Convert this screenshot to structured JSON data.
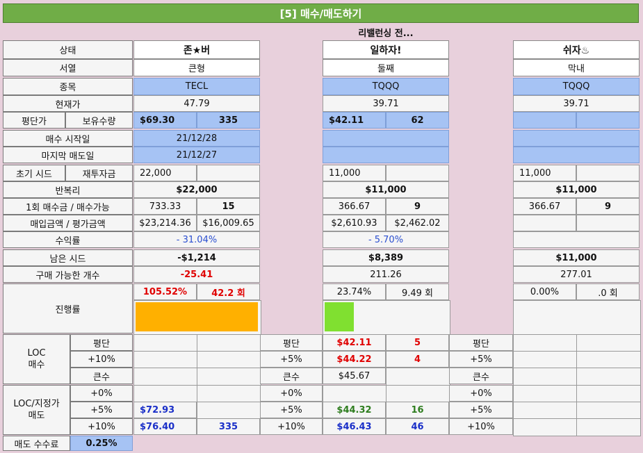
{
  "title": "[5] 매수/매도하기",
  "subtitle": "리밸런싱 전...",
  "labels": {
    "status": "상태",
    "order": "서열",
    "ticker": "종목",
    "price": "현재가",
    "avg": "평단가",
    "qty": "보유수량",
    "buy_start": "매수 시작일",
    "last_sell": "마지막 매도일",
    "seed": "초기 시드",
    "reinvest": "재투자금",
    "compound": "반복리",
    "per_buy": "1회 매수금 / 매수가능",
    "cost_eval": "매입금액 / 평가금액",
    "return": "수익률",
    "remain": "남은 시드",
    "buyable": "구매 가능한 개수",
    "progress": "진행률",
    "loc_buy": "LOC\n매수",
    "loc_sell": "LOC/지정가\n매도",
    "fee": "매도 수수료",
    "fee_value": "0.25%"
  },
  "players": [
    {
      "name": "존★버",
      "rank": "큰형",
      "ticker": "TECL",
      "price": "47.79",
      "avg": "$69.30",
      "qty": "335",
      "buy_start": "21/12/28",
      "last_sell": "21/12/27",
      "seed": "22,000",
      "reinvest": "",
      "compound": "$22,000",
      "per_buy": "733.33",
      "buyable_count": "15",
      "cost": "$23,214.36",
      "eval": "$16,009.65",
      "ret": "- 31.04%",
      "remain": "-$1,214",
      "buyable": "-25.41",
      "progress_pct": "105.52%",
      "progress_times": "42.2 회",
      "progress_fill": 1.0,
      "progress_color": "#ffb000"
    },
    {
      "name": "일하자!",
      "rank": "둘째",
      "ticker": "TQQQ",
      "price": "39.71",
      "avg": "$42.11",
      "qty": "62",
      "buy_start": "",
      "last_sell": "",
      "seed": "11,000",
      "reinvest": "",
      "compound": "$11,000",
      "per_buy": "366.67",
      "buyable_count": "9",
      "cost": "$2,610.93",
      "eval": "$2,462.02",
      "ret": "- 5.70%",
      "remain": "$8,389",
      "buyable": "211.26",
      "progress_pct": "23.74%",
      "progress_times": "9.49 회",
      "progress_fill": 0.2374,
      "progress_color": "#80e030"
    },
    {
      "name": "쉬자♨",
      "rank": "막내",
      "ticker": "TQQQ",
      "price": "39.71",
      "avg": "",
      "qty": "",
      "buy_start": "",
      "last_sell": "",
      "seed": "11,000",
      "reinvest": "",
      "compound": "$11,000",
      "per_buy": "366.67",
      "buyable_count": "9",
      "cost": "",
      "eval": "",
      "ret": "",
      "remain": "$11,000",
      "buyable": "277.01",
      "progress_pct": "0.00%",
      "progress_times": ".0 회",
      "progress_fill": 0,
      "progress_color": "#80e030"
    }
  ],
  "loc_rows": {
    "avg": "평단",
    "p10": "+10%",
    "p5": "+5%",
    "big": "큰수",
    "p0": "+0%"
  },
  "p1_loc_sell": {
    "p5_price": "$72.93",
    "p10_price": "$76.40",
    "p10_qty": "335"
  },
  "p2_loc_buy": {
    "avg_price": "$42.11",
    "avg_qty": "5",
    "p5_price": "$44.22",
    "p5_qty": "4",
    "big_price": "$45.67"
  },
  "p2_loc_sell": {
    "p5_price": "$44.32",
    "p5_qty": "16",
    "p10_price": "$46.43",
    "p10_qty": "46"
  }
}
